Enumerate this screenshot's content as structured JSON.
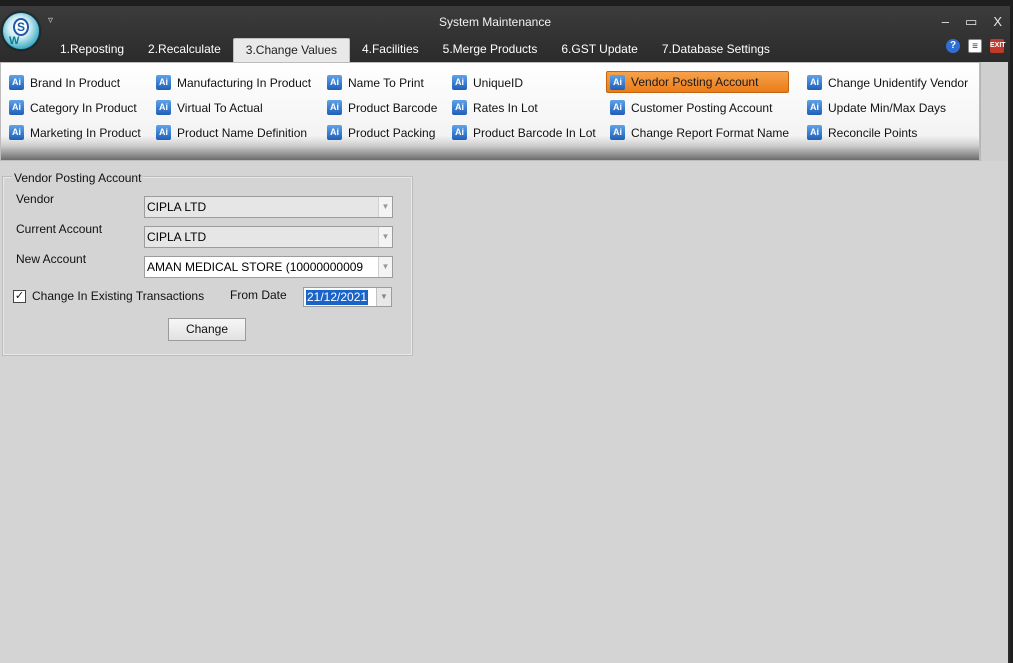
{
  "window": {
    "title": "System Maintenance",
    "qat_glyph": "▿",
    "controls": {
      "minimize": "–",
      "maximize": "▭",
      "close": "X"
    }
  },
  "tabs": [
    {
      "label": "1.Reposting"
    },
    {
      "label": "2.Recalculate"
    },
    {
      "label": "3.Change Values",
      "active": true
    },
    {
      "label": "4.Facilities"
    },
    {
      "label": "5.Merge Products"
    },
    {
      "label": "6.GST Update"
    },
    {
      "label": "7.Database Settings"
    }
  ],
  "ribbon": {
    "columns": [
      [
        "Brand In Product",
        "Category In Product",
        "Marketing In Product"
      ],
      [
        "Manufacturing In Product",
        "Virtual To Actual",
        "Product Name Definition"
      ],
      [
        "Name To Print",
        "Product Barcode",
        "Product Packing"
      ],
      [
        "UniqueID",
        "Rates In Lot",
        "Product Barcode In Lot"
      ],
      [
        "Vendor Posting Account",
        "Customer Posting Account",
        "Change Report Format Name"
      ],
      [
        "Change Unidentify Vendor",
        "Update Min/Max Days",
        "Reconcile Points"
      ]
    ],
    "active_item": "Vendor Posting Account",
    "accent_color": "#ea7c1a"
  },
  "form": {
    "group_title": "Vendor Posting Account",
    "vendor_label": "Vendor",
    "vendor_value": "CIPLA LTD",
    "current_account_label": "Current Account",
    "current_account_value": "CIPLA LTD",
    "new_account_label": "New Account",
    "new_account_value": "AMAN MEDICAL STORE (10000000009",
    "change_existing_label": "Change In Existing Transactions",
    "change_existing_checked": true,
    "from_date_label": "From Date",
    "from_date_value": "21/12/2021",
    "change_button": "Change"
  }
}
